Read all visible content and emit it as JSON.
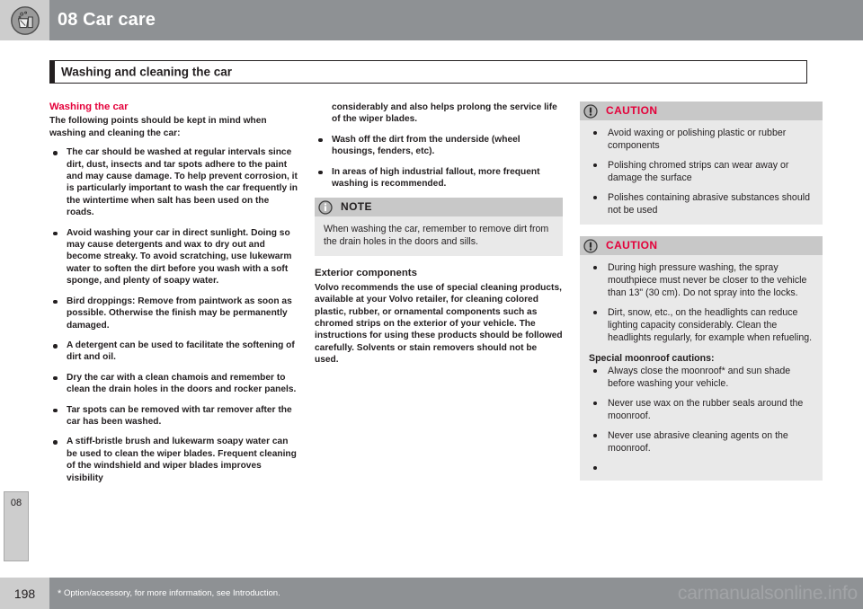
{
  "header": {
    "chapter_title": "08 Car care",
    "icon": "bucket-bubbles-icon"
  },
  "section": {
    "title": "Washing and cleaning the car"
  },
  "chapter_tab": {
    "label": "08"
  },
  "left_column": {
    "heading": "Washing the car",
    "intro": "The following points should be kept in mind when washing and cleaning the car:",
    "bullets": [
      "The car should be washed at regular intervals since dirt, dust, insects and tar spots adhere to the paint and may cause damage. To help prevent corrosion, it is particularly important to wash the car frequently in the wintertime when salt has been used on the roads.",
      "Avoid washing your car in direct sunlight. Doing so may cause detergents and wax to dry out and become streaky. To avoid scratching, use lukewarm water to soften the dirt before you wash with a soft sponge, and plenty of soapy water.",
      "Bird droppings: Remove from paintwork as soon as possible. Otherwise the finish may be permanently damaged.",
      "A detergent can be used to facilitate the softening of dirt and oil.",
      "Dry the car with a clean chamois and remember to clean the drain holes in the doors and rocker panels.",
      "Tar spots can be removed with tar remover after the car has been washed.",
      "A stiff-bristle brush and lukewarm soapy water can be used to clean the wiper blades. Frequent cleaning of the windshield and wiper blades improves visibility"
    ]
  },
  "middle_column": {
    "continuation": "considerably and also helps prolong the service life of the wiper blades.",
    "bullets": [
      "Wash off the dirt from the underside (wheel housings, fenders, etc).",
      "In areas of high industrial fallout, more frequent washing is recommended."
    ],
    "note_box": {
      "icon": "info-icon",
      "title": "NOTE",
      "text": "When washing the car, remember to remove dirt from the drain holes in the doors and sills."
    },
    "subheading": "Exterior components",
    "paragraph": "Volvo recommends the use of special cleaning products, available at your Volvo retailer, for cleaning colored plastic, rubber, or ornamental components such as chromed strips on the exterior of your vehicle. The instructions for using these products should be followed carefully. Solvents or stain removers should not be used."
  },
  "right_column": {
    "caution_1": {
      "icon": "exclamation-icon",
      "title": "CAUTION",
      "bullets": [
        "Avoid waxing or polishing plastic or rubber components",
        "Polishing chromed strips can wear away or damage the surface",
        "Polishes containing abrasive substances should not be used"
      ]
    },
    "caution_2": {
      "icon": "exclamation-icon",
      "title": "CAUTION",
      "bullets": [
        "During high pressure washing, the spray mouthpiece must never be closer to the vehicle than 13\" (30 cm). Do not spray into the locks.",
        "Dirt, snow, etc., on the headlights can reduce lighting capacity considerably. Clean the headlights regularly, for example when refueling."
      ],
      "subhead": "Special moonroof cautions:",
      "moonroof_bullets": [
        "Always close the moonroof* and sun shade before washing your vehicle.",
        "Never use wax on the rubber seals around the moonroof.",
        "Never use abrasive cleaning agents on the moonroof.",
        ""
      ]
    }
  },
  "footer": {
    "page_number": "198",
    "footnote_marker": "*",
    "footnote": "Option/accessory, for more information, see Introduction.",
    "watermark": "carmanualsonline.info"
  },
  "colors": {
    "header_gray": "#8e9194",
    "tab_gray": "#cdcdcd",
    "accent_red": "#e4003a",
    "box_bg": "#e9e9e9",
    "box_head": "#c8c8c8",
    "text": "#231f20"
  }
}
